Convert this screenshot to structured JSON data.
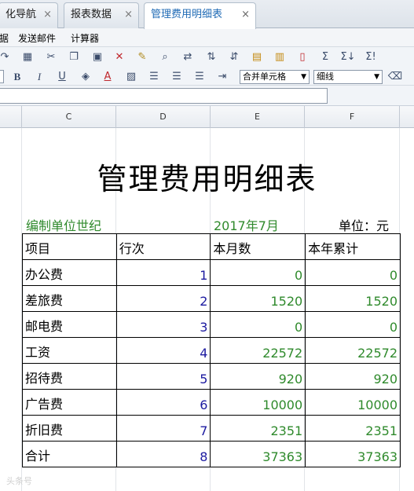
{
  "tabs": [
    {
      "label": "化导航",
      "close": "×"
    },
    {
      "label": "报表数据",
      "close": "×"
    },
    {
      "label": "管理费用明细表",
      "close": "×"
    }
  ],
  "menu": {
    "items": [
      "据",
      "发送邮件",
      "计算器"
    ]
  },
  "toolbar": {
    "merge_select": "合并单元格",
    "border_select": "细线",
    "bold": "B",
    "italic": "I",
    "underline": "U",
    "font_color": "A",
    "sum": "Σ",
    "sum_sub": "Σ↓",
    "sum_avg": "Σ!"
  },
  "columns": [
    "C",
    "D",
    "E",
    "F"
  ],
  "report": {
    "title": "管理费用明细表",
    "unit_label": "编制单位世纪",
    "period": "2017年7月",
    "currency": "单位：元",
    "headers": [
      "项目",
      "行次",
      "本月数",
      "本年累计"
    ],
    "rows": [
      {
        "item": "办公费",
        "line": "1",
        "month": "0",
        "year": "0"
      },
      {
        "item": "差旅费",
        "line": "2",
        "month": "1520",
        "year": "1520"
      },
      {
        "item": "邮电费",
        "line": "3",
        "month": "0",
        "year": "0"
      },
      {
        "item": "工资",
        "line": "4",
        "month": "22572",
        "year": "22572"
      },
      {
        "item": "招待费",
        "line": "5",
        "month": "920",
        "year": "920"
      },
      {
        "item": "广告费",
        "line": "6",
        "month": "10000",
        "year": "10000"
      },
      {
        "item": "折旧费",
        "line": "7",
        "month": "2351",
        "year": "2351"
      },
      {
        "item": "合计",
        "line": "8",
        "month": "37363",
        "year": "37363"
      }
    ]
  },
  "colors": {
    "green_text": "#2f8a2c",
    "blue_text": "#1c1aa0",
    "active_tab_text": "#1f6ab5"
  },
  "watermark": "头条号"
}
